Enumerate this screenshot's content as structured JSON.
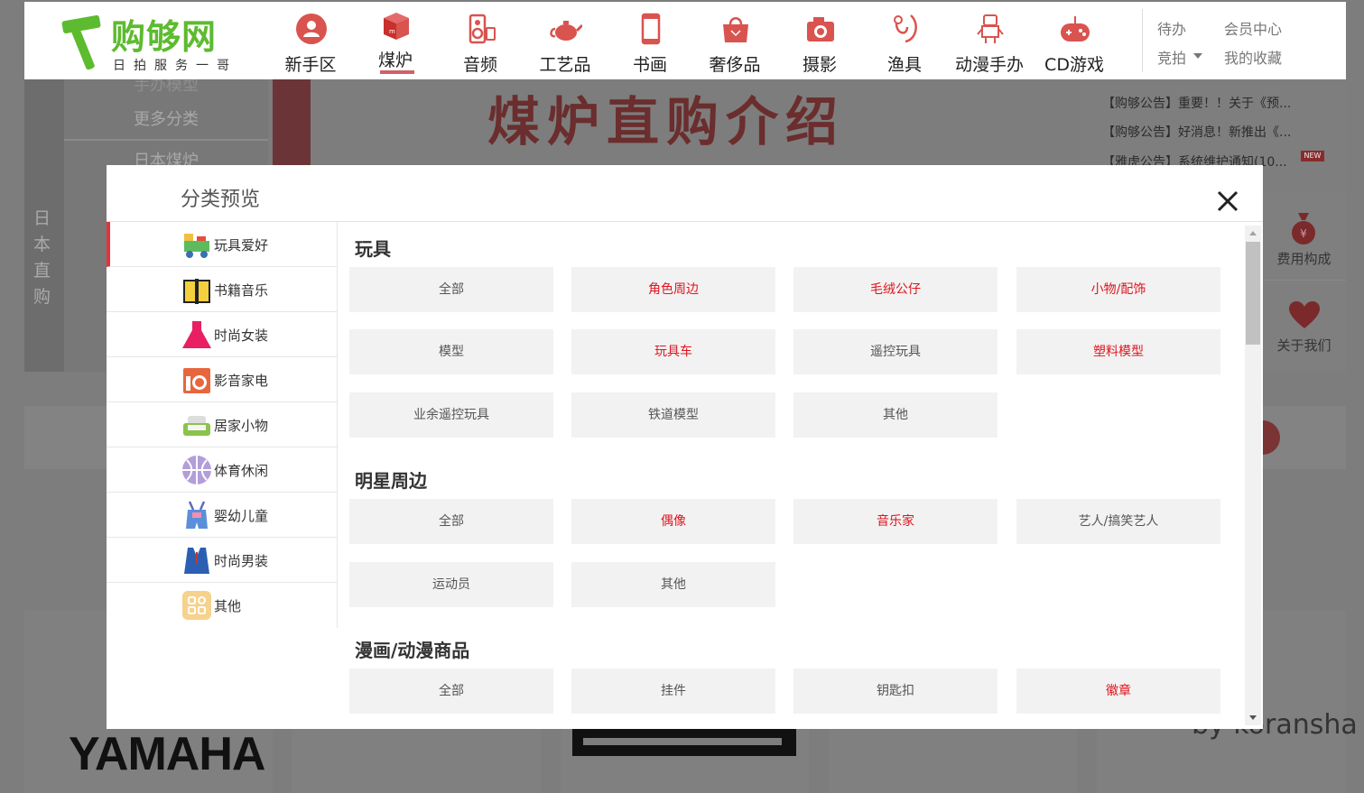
{
  "header": {
    "logo_name": "购够网",
    "logo_sub": "日拍服务一哥",
    "nav": [
      {
        "label": "新手区",
        "icon": "user-circle-icon"
      },
      {
        "label": "煤炉",
        "icon": "box-icon",
        "active": true
      },
      {
        "label": "音频",
        "icon": "speaker-icon"
      },
      {
        "label": "工艺品",
        "icon": "teapot-icon"
      },
      {
        "label": "书画",
        "icon": "scroll-icon"
      },
      {
        "label": "奢侈品",
        "icon": "handbag-icon"
      },
      {
        "label": "摄影",
        "icon": "camera-icon"
      },
      {
        "label": "渔具",
        "icon": "fishing-hook-icon"
      },
      {
        "label": "动漫手办",
        "icon": "robot-icon"
      },
      {
        "label": "CD游戏",
        "icon": "gamepad-icon"
      }
    ],
    "right": {
      "pending": "待办",
      "member_center": "会员中心",
      "auction": "竞拍",
      "favorites": "我的收藏"
    }
  },
  "background": {
    "cat_more": "更多分类",
    "cat_top": "手办模型",
    "cat_next": "日本煤炉",
    "vertical_text": "日本直购",
    "banner_title": "煤炉直购介绍",
    "notices": [
      "【购够公告】重要！！关于《预...",
      "【购够公告】好消息！新推出《...",
      "【雅虎公告】系统维护通知(10..."
    ],
    "new_badge": "NEW",
    "side_fee": "费用构成",
    "side_about": "关于我们",
    "brand_yamaha": "YAMAHA",
    "brand_koransha": "by koransha"
  },
  "modal": {
    "title": "分类预览",
    "sidebar": [
      {
        "label": "玩具爱好",
        "icon": "toy-train-icon",
        "active": true
      },
      {
        "label": "书籍音乐",
        "icon": "book-icon"
      },
      {
        "label": "时尚女装",
        "icon": "dress-icon"
      },
      {
        "label": "影音家电",
        "icon": "appliance-icon"
      },
      {
        "label": "居家小物",
        "icon": "sofa-icon"
      },
      {
        "label": "体育休闲",
        "icon": "basketball-icon"
      },
      {
        "label": "婴幼儿童",
        "icon": "baby-overalls-icon"
      },
      {
        "label": "时尚男装",
        "icon": "suit-icon"
      },
      {
        "label": "其他",
        "icon": "grid-icon"
      }
    ],
    "sections": [
      {
        "title": "玩具",
        "items": [
          {
            "label": "全部",
            "hot": false
          },
          {
            "label": "角色周边",
            "hot": true
          },
          {
            "label": "毛绒公仔",
            "hot": true
          },
          {
            "label": "小物/配饰",
            "hot": true
          },
          {
            "label": "模型",
            "hot": false
          },
          {
            "label": "玩具车",
            "hot": true
          },
          {
            "label": "遥控玩具",
            "hot": false
          },
          {
            "label": "塑料模型",
            "hot": true
          },
          {
            "label": "业余遥控玩具",
            "hot": false
          },
          {
            "label": "铁道模型",
            "hot": false
          },
          {
            "label": "其他",
            "hot": false
          }
        ]
      },
      {
        "title": "明星周边",
        "items": [
          {
            "label": "全部",
            "hot": false
          },
          {
            "label": "偶像",
            "hot": true
          },
          {
            "label": "音乐家",
            "hot": true
          },
          {
            "label": "艺人/搞笑艺人",
            "hot": false
          },
          {
            "label": "运动员",
            "hot": false
          },
          {
            "label": "其他",
            "hot": false
          }
        ]
      },
      {
        "title": "漫画/动漫商品",
        "items": [
          {
            "label": "全部",
            "hot": false
          },
          {
            "label": "挂件",
            "hot": false
          },
          {
            "label": "钥匙扣",
            "hot": false
          },
          {
            "label": "徽章",
            "hot": true
          }
        ]
      }
    ]
  },
  "colors": {
    "accent_red": "#e0141e",
    "active_bar": "#e5323e",
    "logo_green": "#5dbb2f",
    "overlay": "#7d7d7d"
  }
}
